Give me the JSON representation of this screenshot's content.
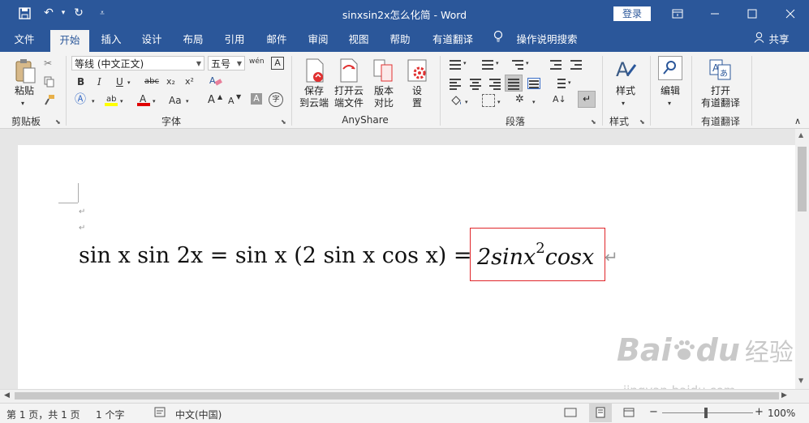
{
  "titlebar": {
    "title": "sinxsin2x怎么化简  -  Word",
    "login_label": "登录"
  },
  "tabs": [
    {
      "label": "文件"
    },
    {
      "label": "开始"
    },
    {
      "label": "插入"
    },
    {
      "label": "设计"
    },
    {
      "label": "布局"
    },
    {
      "label": "引用"
    },
    {
      "label": "邮件"
    },
    {
      "label": "审阅"
    },
    {
      "label": "视图"
    },
    {
      "label": "帮助"
    },
    {
      "label": "有道翻译"
    }
  ],
  "tell_me": "操作说明搜索",
  "share": "共享",
  "ribbon": {
    "clipboard": {
      "paste": "粘贴",
      "label": "剪贴板"
    },
    "font": {
      "font_name": "等线 (中文正文)",
      "font_size": "五号",
      "label": "字体",
      "bold": "B",
      "italic": "I",
      "underline": "U",
      "strike": "abc",
      "sub": "x₂",
      "sup": "x²",
      "aa": "Aa",
      "grow": "A",
      "shrink": "A",
      "wen": "wén",
      "char_border": "A",
      "char_shade": "A",
      "enclose": "字"
    },
    "anyshare": {
      "save_cloud": [
        "保存",
        "到云端"
      ],
      "open_cloud": [
        "打开云",
        "端文件"
      ],
      "compare": [
        "版本",
        "对比"
      ],
      "settings": [
        "设",
        "置"
      ],
      "label": "AnyShare"
    },
    "paragraph": {
      "label": "段落"
    },
    "styles": {
      "button": "样式",
      "label": "样式"
    },
    "editing": {
      "button": "编辑"
    },
    "youdao": {
      "button": [
        "打开",
        "有道翻译"
      ],
      "label": "有道翻译"
    }
  },
  "document": {
    "equation_main": "sin x sin 2x = sin x (2 sin x cos x) = ",
    "equation_highlight": {
      "pre": "2sinx",
      "sup": "2",
      "post": "cosx"
    }
  },
  "watermark": {
    "brand": "Bai",
    "paw": "du",
    "cn": "经验",
    "url": "jingyan.baidu.com"
  },
  "statusbar": {
    "page": "第 1 页，共 1 页",
    "words": "1 个字",
    "language": "中文(中国)",
    "zoom": "100%"
  }
}
